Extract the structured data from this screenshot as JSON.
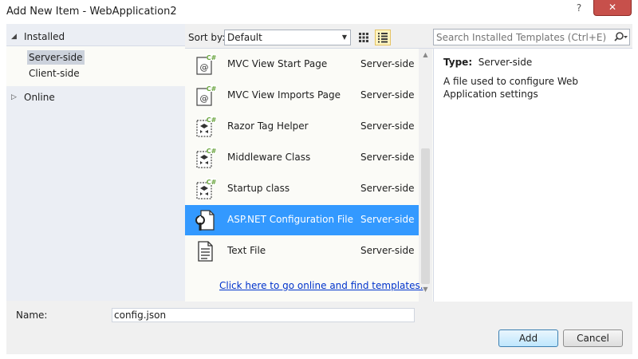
{
  "window": {
    "title": "Add New Item - WebApplication2",
    "help_glyph": "?",
    "close_glyph": "✕",
    "close_color": "#c7504b"
  },
  "sidebar": {
    "installed": {
      "arrow": "◢",
      "label": "Installed"
    },
    "items": [
      {
        "label": "Server-side",
        "selected": true
      },
      {
        "label": "Client-side",
        "selected": false
      }
    ],
    "online": {
      "arrow": "▷",
      "label": "Online"
    }
  },
  "toolbar": {
    "sort_label": "Sort by:",
    "sort_value": "Default",
    "view_modes": [
      "medium-icons-icon",
      "list-view-icon"
    ],
    "active_view": "list-view-icon"
  },
  "search": {
    "placeholder": "Search Installed Templates (Ctrl+E)",
    "value": ""
  },
  "templates": [
    {
      "name": "MVC View Start Page",
      "language": "Server-side",
      "icon": "razor-view-icon",
      "selected": false
    },
    {
      "name": "MVC View Imports Page",
      "language": "Server-side",
      "icon": "razor-view-icon",
      "selected": false
    },
    {
      "name": "Razor Tag Helper",
      "language": "Server-side",
      "icon": "csharp-class-icon",
      "selected": false
    },
    {
      "name": "Middleware Class",
      "language": "Server-side",
      "icon": "csharp-class-icon",
      "selected": false
    },
    {
      "name": "Startup class",
      "language": "Server-side",
      "icon": "csharp-class-icon",
      "selected": false
    },
    {
      "name": "ASP.NET Configuration File",
      "language": "Server-side",
      "icon": "config-file-icon",
      "selected": true
    },
    {
      "name": "Text File",
      "language": "Server-side",
      "icon": "text-file-icon",
      "selected": false
    }
  ],
  "online_link": "Click here to go online and find templates.",
  "detail": {
    "type_label": "Type:",
    "type_value": "Server-side",
    "description": "A file used to configure Web Application settings"
  },
  "form": {
    "name_label": "Name:",
    "name_value": "config.json"
  },
  "buttons": {
    "add": "Add",
    "cancel": "Cancel"
  },
  "colors": {
    "selection": "#3399ff",
    "csharp_badge": "#68a33c",
    "link": "#0033cc"
  }
}
